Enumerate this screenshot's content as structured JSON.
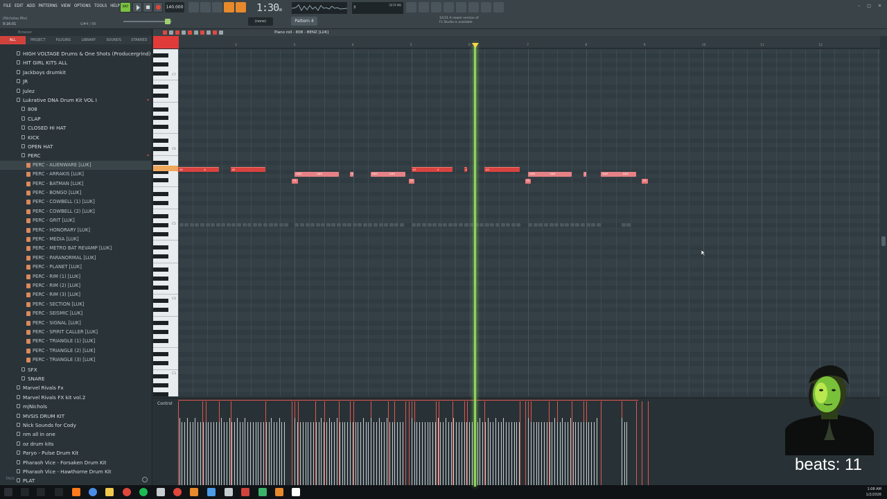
{
  "menu": [
    "FILE",
    "EDIT",
    "ADD",
    "PATTERNS",
    "VIEW",
    "OPTIONS",
    "TOOLS",
    "HELP"
  ],
  "hint": {
    "name": "(Nicholas Mix)",
    "position": "9:16:01",
    "note": "G#4 / 56"
  },
  "transport": {
    "pat_label": "PAT",
    "tempo": "140.000",
    "time": "1:30",
    "time_small": "99",
    "time_unit": "M:S:CS"
  },
  "cpu": {
    "mem": "5679 MB",
    "voices": "3",
    "value": "0"
  },
  "snap": "(none)",
  "pattern": "Pattern 4",
  "notice": [
    "12/31  A newer version of",
    "FL Studio is available"
  ],
  "browser": {
    "title": "Browser",
    "tabs": [
      "ALL",
      "PROJECT",
      "PLUGINS",
      "LIBRARY",
      "SOUNDS",
      "STARRED"
    ],
    "items": [
      {
        "label": "HIGH VOLTAGE Drums & One Shots (Producergrind)",
        "depth": 1,
        "kind": "folder"
      },
      {
        "label": "HIT GIRL KITS ALL",
        "depth": 1,
        "kind": "folder"
      },
      {
        "label": "Jackboys drumkit",
        "depth": 1,
        "kind": "folder"
      },
      {
        "label": "JR",
        "depth": 1,
        "kind": "folder"
      },
      {
        "label": "Julez",
        "depth": 1,
        "kind": "folder"
      },
      {
        "label": "Lukrative DNA Drum Kit VOL I",
        "depth": 1,
        "kind": "folder",
        "open": true
      },
      {
        "label": "808",
        "depth": 2,
        "kind": "folder"
      },
      {
        "label": "CLAP",
        "depth": 2,
        "kind": "folder"
      },
      {
        "label": "CLOSED HI HAT",
        "depth": 2,
        "kind": "folder"
      },
      {
        "label": "KICK",
        "depth": 2,
        "kind": "folder"
      },
      {
        "label": "OPEN HAT",
        "depth": 2,
        "kind": "folder"
      },
      {
        "label": "PERC",
        "depth": 2,
        "kind": "folder",
        "open": true
      },
      {
        "label": "PERC - ALIENWARE [LUK]",
        "depth": 3,
        "kind": "file",
        "selected": true
      },
      {
        "label": "PERC - ARRAKIS [LUK]",
        "depth": 3,
        "kind": "file"
      },
      {
        "label": "PERC - BATMAN [LUK]",
        "depth": 3,
        "kind": "file"
      },
      {
        "label": "PERC - BONGO [LUK]",
        "depth": 3,
        "kind": "file"
      },
      {
        "label": "PERC - COWBELL (1) [LUK]",
        "depth": 3,
        "kind": "file"
      },
      {
        "label": "PERC - COWBELL (2) [LUK]",
        "depth": 3,
        "kind": "file"
      },
      {
        "label": "PERC - GRIT [LUK]",
        "depth": 3,
        "kind": "file"
      },
      {
        "label": "PERC - HONORARY [LUK]",
        "depth": 3,
        "kind": "file"
      },
      {
        "label": "PERC - MEDIA [LUK]",
        "depth": 3,
        "kind": "file"
      },
      {
        "label": "PERC - METRO BAT REVAMP [LUK]",
        "depth": 3,
        "kind": "file"
      },
      {
        "label": "PERC - PARANORMAL [LUK]",
        "depth": 3,
        "kind": "file"
      },
      {
        "label": "PERC - PLANET [LUK]",
        "depth": 3,
        "kind": "file"
      },
      {
        "label": "PERC - RIM (1) [LUK]",
        "depth": 3,
        "kind": "file"
      },
      {
        "label": "PERC - RIM (2) [LUK]",
        "depth": 3,
        "kind": "file"
      },
      {
        "label": "PERC - RIM (3) [LUK]",
        "depth": 3,
        "kind": "file"
      },
      {
        "label": "PERC - SECTION [LUK]",
        "depth": 3,
        "kind": "file"
      },
      {
        "label": "PERC - SEISMIC [LUK]",
        "depth": 3,
        "kind": "file"
      },
      {
        "label": "PERC - SIGNAL [LUK]",
        "depth": 3,
        "kind": "file"
      },
      {
        "label": "PERC - SPIRIT CALLER [LUK]",
        "depth": 3,
        "kind": "file"
      },
      {
        "label": "PERC - TRIANGLE (1) [LUK]",
        "depth": 3,
        "kind": "file"
      },
      {
        "label": "PERC - TRIANGLE (2) [LUK]",
        "depth": 3,
        "kind": "file"
      },
      {
        "label": "PERC - TRIANGLE (3) [LUK]",
        "depth": 3,
        "kind": "file"
      },
      {
        "label": "SFX",
        "depth": 2,
        "kind": "folder"
      },
      {
        "label": "SNARE",
        "depth": 2,
        "kind": "folder"
      },
      {
        "label": "Marvel Rivals Fx",
        "depth": 1,
        "kind": "folder"
      },
      {
        "label": "Marvel Rivals FX kit vol.2",
        "depth": 1,
        "kind": "folder"
      },
      {
        "label": "mjNichols",
        "depth": 1,
        "kind": "folder"
      },
      {
        "label": "MVSIS DRUM KIT",
        "depth": 1,
        "kind": "folder"
      },
      {
        "label": "Nick Sounds for Cody",
        "depth": 1,
        "kind": "folder"
      },
      {
        "label": "nm all in one",
        "depth": 1,
        "kind": "folder"
      },
      {
        "label": "oz drum kits",
        "depth": 1,
        "kind": "folder"
      },
      {
        "label": "Paryo - Pulse Drum Kit",
        "depth": 1,
        "kind": "folder"
      },
      {
        "label": "Pharaoh Vice - Forsaken Drum Kit",
        "depth": 1,
        "kind": "folder"
      },
      {
        "label": "Pharaoh Vice - Hawthorne Drum Kit",
        "depth": 1,
        "kind": "folder"
      },
      {
        "label": "PLAT",
        "depth": 1,
        "kind": "folder"
      }
    ],
    "footer": "TAGS"
  },
  "piano_roll": {
    "title": "Piano roll - 808 - BENZ [LUK]",
    "bars": [
      "2",
      "3",
      "4",
      "5",
      "6",
      "7",
      "8",
      "9",
      "10",
      "11",
      "12"
    ],
    "octaves": [
      "C7",
      "C6",
      "C5",
      "C4",
      "C3"
    ],
    "notes": [
      {
        "label": "A5",
        "start": 1.0,
        "len": 0.7,
        "pitch": "A5"
      },
      {
        "label": "A5",
        "start": 1.42,
        "len": 0.05,
        "pitch": "A5"
      },
      {
        "label": "A5",
        "start": 1.9,
        "len": 0.6,
        "pitch": "A5"
      },
      {
        "label": "G#5",
        "start": 3.0,
        "len": 0.5,
        "pitch": "G5"
      },
      {
        "label": "G#5",
        "start": 3.35,
        "len": 0.4,
        "pitch": "G5"
      },
      {
        "label": "G#5",
        "start": 3.95,
        "len": 0.05,
        "pitch": "G5"
      },
      {
        "label": "F5",
        "start": 2.95,
        "len": 0.1,
        "pitch": "F5"
      },
      {
        "label": "G#5",
        "start": 4.3,
        "len": 0.4,
        "pitch": "G5"
      },
      {
        "label": "G#5",
        "start": 4.6,
        "len": 0.3,
        "pitch": "G5"
      },
      {
        "label": "F5",
        "start": 4.95,
        "len": 0.1,
        "pitch": "F5"
      },
      {
        "label": "A5",
        "start": 5.0,
        "len": 0.7,
        "pitch": "A5"
      },
      {
        "label": "A5",
        "start": 5.42,
        "len": 0.05,
        "pitch": "A5"
      },
      {
        "label": "A5",
        "start": 5.9,
        "len": 0.05,
        "pitch": "A5"
      },
      {
        "label": "A5",
        "start": 6.25,
        "len": 0.6,
        "pitch": "A5"
      },
      {
        "label": "G#5",
        "start": 7.0,
        "len": 0.5,
        "pitch": "G5"
      },
      {
        "label": "G#5",
        "start": 7.35,
        "len": 0.4,
        "pitch": "G5"
      },
      {
        "label": "G#5",
        "start": 7.95,
        "len": 0.05,
        "pitch": "G5"
      },
      {
        "label": "F5",
        "start": 6.95,
        "len": 0.1,
        "pitch": "F5"
      },
      {
        "label": "G#5",
        "start": 8.25,
        "len": 0.35,
        "pitch": "G5"
      },
      {
        "label": "G#5",
        "start": 8.6,
        "len": 0.25,
        "pitch": "G5"
      },
      {
        "label": "F5",
        "start": 8.95,
        "len": 0.1,
        "pitch": "F5"
      }
    ],
    "ghost_label": "G#5",
    "lane_label": "Control"
  },
  "overlay": {
    "beats": "beats: 11"
  },
  "clock": {
    "time": "1:08 AM",
    "date": "1/2/2026"
  },
  "colors": {
    "accent": "#d0433d",
    "playhead": "#8fd35a",
    "note_red": "#d9433f",
    "note_pink": "#e68285"
  }
}
